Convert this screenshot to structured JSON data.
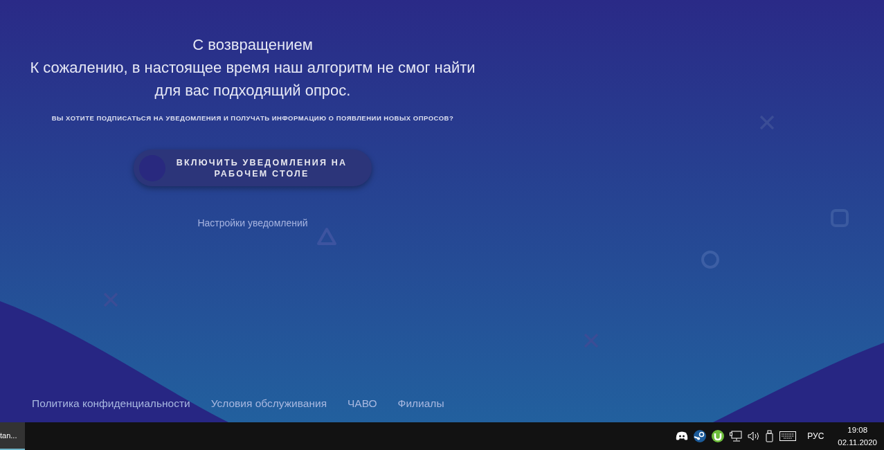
{
  "page": {
    "greeting": "С возвращением",
    "message": "К сожалению, в настоящее время наш алгоритм не смог найти для вас подходящий опрос.",
    "question": "ВЫ ХОТИТЕ ПОДПИСАТЬСЯ НА УВЕДОМЛЕНИЯ И ПОЛУЧАТЬ ИНФОРМАЦИЮ О ПОЯВЛЕНИИ НОВЫХ ОПРОСОВ?",
    "enable_button": "ВКЛЮЧИТЬ УВЕДОМЛЕНИЯ НА РАБОЧЕМ СТОЛЕ",
    "settings_link": "Настройки уведомлений"
  },
  "footer_links": [
    "Политика конфиденциальности",
    "Условия обслуживания",
    "ЧАВО",
    "Филиалы"
  ],
  "taskbar": {
    "task": "tan...",
    "language": "РУС",
    "time": "19:08",
    "date": "02.11.2020"
  }
}
